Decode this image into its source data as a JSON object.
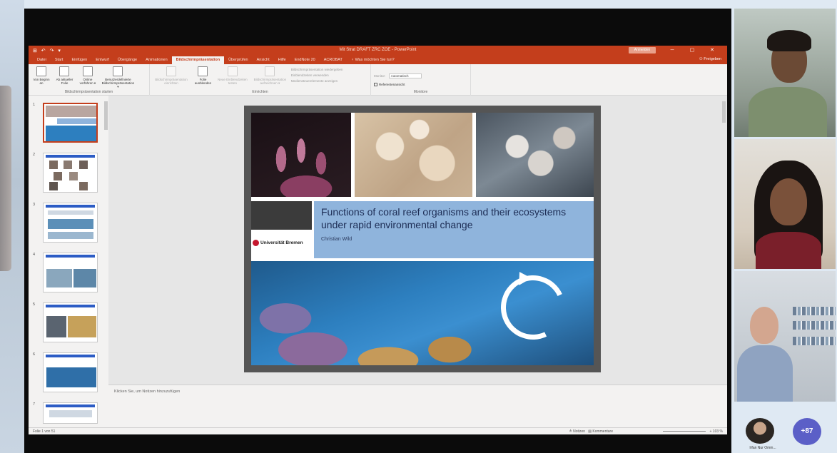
{
  "powerpoint": {
    "window_title": "Mit Strat DRAFT ZRC ZOE - PowerPoint",
    "quick_access": "⊞ ↶ ↷ ▾",
    "sign_in_label": "Anmelden",
    "window_controls": "─ ▢ ✕",
    "tabs": [
      {
        "label": "Datei"
      },
      {
        "label": "Start"
      },
      {
        "label": "Einfügen"
      },
      {
        "label": "Entwurf"
      },
      {
        "label": "Übergänge"
      },
      {
        "label": "Animationen"
      },
      {
        "label": "Bildschirmpräsentation"
      },
      {
        "label": "Überprüfen"
      },
      {
        "label": "Ansicht"
      },
      {
        "label": "Hilfe"
      },
      {
        "label": "EndNote 20"
      },
      {
        "label": "ACROBAT"
      },
      {
        "label": "♀ Was möchten Sie tun?"
      }
    ],
    "share_label": "⚇ Freigeben",
    "ribbon": {
      "start_group_label": "Bildschirmpräsentation starten",
      "start_buttons": [
        "Von Beginn an",
        "Ab aktueller Folie",
        "Online vorführen ▾",
        "Benutzerdefinierte Bildschirmpräsentation ▾"
      ],
      "setup_group_label": "Einrichten",
      "setup_buttons": [
        "Bildschirmpräsentation einrichten",
        "Folie ausblenden",
        "Neue Einblendzeiten testen",
        "Bildschirmpräsentation aufzeichnen ▾"
      ],
      "setup_options": [
        "Bildschirmpräsentation wiedergeben",
        "Einblendzeiten verwenden",
        "Mediensteuerelemente anzeigen"
      ],
      "monitor_group_label": "Monitore",
      "monitor_label": "Monitor:",
      "monitor_value": "Automatisch",
      "presenter_view_label": "Referentenansicht"
    },
    "thumbnail_numbers": [
      "1",
      "2",
      "3",
      "4",
      "5",
      "6",
      "7"
    ],
    "slide": {
      "title_line1": "Functions of coral reef organisms and their ecosystems",
      "title_line2": "under rapid environmental change",
      "author": "Christian Wild",
      "university": "Universität Bremen"
    },
    "notes_placeholder": "Klicken Sie, um Notizen hinzuzufügen",
    "status": {
      "slide_counter": "Folie 1 von 51",
      "notes_button": "≜ Notizen",
      "comments_button": "▤ Kommentare",
      "zoom": "+ 103 %"
    }
  },
  "meeting": {
    "self_name": "Irfan Nur Omm...",
    "more_participants": "+87"
  }
}
